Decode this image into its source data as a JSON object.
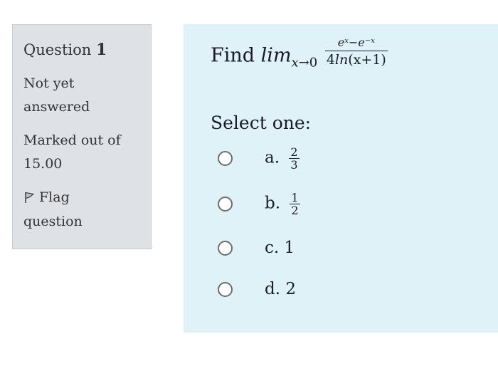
{
  "question_info": {
    "label": "Question",
    "number": "1",
    "state": "Not yet answered",
    "grade": "Marked out of 15.00",
    "flag_label": "Flag question"
  },
  "question": {
    "find_text": "Find",
    "lim_text": "lim",
    "lim_sub_var": "x",
    "lim_sub_arrow": "→0",
    "numerator": "eˣ−e⁻ˣ",
    "denominator_coeff": "4",
    "denominator_fn": "ln",
    "denominator_arg": "(x+1)"
  },
  "prompt": "Select one:",
  "options": [
    {
      "letter": "a.",
      "num": "2",
      "den": "3"
    },
    {
      "letter": "b.",
      "num": "1",
      "den": "2"
    },
    {
      "letter": "c.",
      "value": "1"
    },
    {
      "letter": "d.",
      "value": "2"
    }
  ],
  "colors": {
    "info_bg": "#dee2e6",
    "content_bg": "#def2f8",
    "radio_border": "#6d6d6d"
  }
}
